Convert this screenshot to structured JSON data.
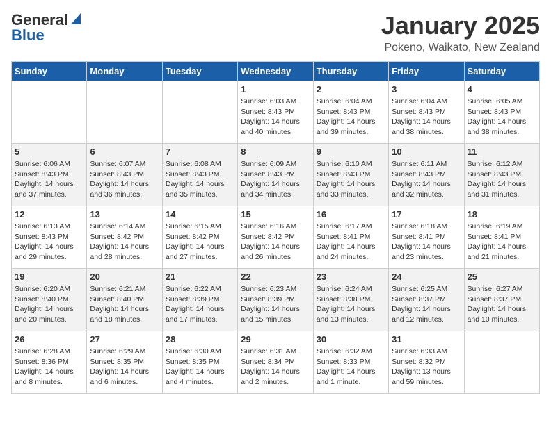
{
  "header": {
    "logo_general": "General",
    "logo_blue": "Blue",
    "month": "January 2025",
    "location": "Pokeno, Waikato, New Zealand"
  },
  "days_of_week": [
    "Sunday",
    "Monday",
    "Tuesday",
    "Wednesday",
    "Thursday",
    "Friday",
    "Saturday"
  ],
  "weeks": [
    [
      {
        "day": "",
        "info": ""
      },
      {
        "day": "",
        "info": ""
      },
      {
        "day": "",
        "info": ""
      },
      {
        "day": "1",
        "info": "Sunrise: 6:03 AM\nSunset: 8:43 PM\nDaylight: 14 hours\nand 40 minutes."
      },
      {
        "day": "2",
        "info": "Sunrise: 6:04 AM\nSunset: 8:43 PM\nDaylight: 14 hours\nand 39 minutes."
      },
      {
        "day": "3",
        "info": "Sunrise: 6:04 AM\nSunset: 8:43 PM\nDaylight: 14 hours\nand 38 minutes."
      },
      {
        "day": "4",
        "info": "Sunrise: 6:05 AM\nSunset: 8:43 PM\nDaylight: 14 hours\nand 38 minutes."
      }
    ],
    [
      {
        "day": "5",
        "info": "Sunrise: 6:06 AM\nSunset: 8:43 PM\nDaylight: 14 hours\nand 37 minutes."
      },
      {
        "day": "6",
        "info": "Sunrise: 6:07 AM\nSunset: 8:43 PM\nDaylight: 14 hours\nand 36 minutes."
      },
      {
        "day": "7",
        "info": "Sunrise: 6:08 AM\nSunset: 8:43 PM\nDaylight: 14 hours\nand 35 minutes."
      },
      {
        "day": "8",
        "info": "Sunrise: 6:09 AM\nSunset: 8:43 PM\nDaylight: 14 hours\nand 34 minutes."
      },
      {
        "day": "9",
        "info": "Sunrise: 6:10 AM\nSunset: 8:43 PM\nDaylight: 14 hours\nand 33 minutes."
      },
      {
        "day": "10",
        "info": "Sunrise: 6:11 AM\nSunset: 8:43 PM\nDaylight: 14 hours\nand 32 minutes."
      },
      {
        "day": "11",
        "info": "Sunrise: 6:12 AM\nSunset: 8:43 PM\nDaylight: 14 hours\nand 31 minutes."
      }
    ],
    [
      {
        "day": "12",
        "info": "Sunrise: 6:13 AM\nSunset: 8:43 PM\nDaylight: 14 hours\nand 29 minutes."
      },
      {
        "day": "13",
        "info": "Sunrise: 6:14 AM\nSunset: 8:42 PM\nDaylight: 14 hours\nand 28 minutes."
      },
      {
        "day": "14",
        "info": "Sunrise: 6:15 AM\nSunset: 8:42 PM\nDaylight: 14 hours\nand 27 minutes."
      },
      {
        "day": "15",
        "info": "Sunrise: 6:16 AM\nSunset: 8:42 PM\nDaylight: 14 hours\nand 26 minutes."
      },
      {
        "day": "16",
        "info": "Sunrise: 6:17 AM\nSunset: 8:41 PM\nDaylight: 14 hours\nand 24 minutes."
      },
      {
        "day": "17",
        "info": "Sunrise: 6:18 AM\nSunset: 8:41 PM\nDaylight: 14 hours\nand 23 minutes."
      },
      {
        "day": "18",
        "info": "Sunrise: 6:19 AM\nSunset: 8:41 PM\nDaylight: 14 hours\nand 21 minutes."
      }
    ],
    [
      {
        "day": "19",
        "info": "Sunrise: 6:20 AM\nSunset: 8:40 PM\nDaylight: 14 hours\nand 20 minutes."
      },
      {
        "day": "20",
        "info": "Sunrise: 6:21 AM\nSunset: 8:40 PM\nDaylight: 14 hours\nand 18 minutes."
      },
      {
        "day": "21",
        "info": "Sunrise: 6:22 AM\nSunset: 8:39 PM\nDaylight: 14 hours\nand 17 minutes."
      },
      {
        "day": "22",
        "info": "Sunrise: 6:23 AM\nSunset: 8:39 PM\nDaylight: 14 hours\nand 15 minutes."
      },
      {
        "day": "23",
        "info": "Sunrise: 6:24 AM\nSunset: 8:38 PM\nDaylight: 14 hours\nand 13 minutes."
      },
      {
        "day": "24",
        "info": "Sunrise: 6:25 AM\nSunset: 8:37 PM\nDaylight: 14 hours\nand 12 minutes."
      },
      {
        "day": "25",
        "info": "Sunrise: 6:27 AM\nSunset: 8:37 PM\nDaylight: 14 hours\nand 10 minutes."
      }
    ],
    [
      {
        "day": "26",
        "info": "Sunrise: 6:28 AM\nSunset: 8:36 PM\nDaylight: 14 hours\nand 8 minutes."
      },
      {
        "day": "27",
        "info": "Sunrise: 6:29 AM\nSunset: 8:35 PM\nDaylight: 14 hours\nand 6 minutes."
      },
      {
        "day": "28",
        "info": "Sunrise: 6:30 AM\nSunset: 8:35 PM\nDaylight: 14 hours\nand 4 minutes."
      },
      {
        "day": "29",
        "info": "Sunrise: 6:31 AM\nSunset: 8:34 PM\nDaylight: 14 hours\nand 2 minutes."
      },
      {
        "day": "30",
        "info": "Sunrise: 6:32 AM\nSunset: 8:33 PM\nDaylight: 14 hours\nand 1 minute."
      },
      {
        "day": "31",
        "info": "Sunrise: 6:33 AM\nSunset: 8:32 PM\nDaylight: 13 hours\nand 59 minutes."
      },
      {
        "day": "",
        "info": ""
      }
    ]
  ]
}
